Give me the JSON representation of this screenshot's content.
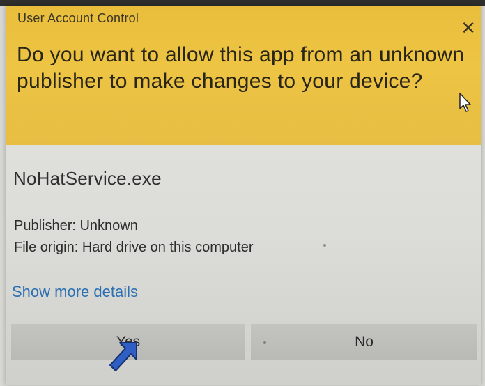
{
  "window": {
    "title": "User Account Control",
    "close_symbol": "✕"
  },
  "header": {
    "question": "Do you want to allow this app from an unknown publisher to make changes to your device?",
    "background_color": "#ecc342"
  },
  "app": {
    "name": "NoHatService.exe",
    "publisher": "Publisher: Unknown",
    "file_origin": "File origin: Hard drive on this computer"
  },
  "links": {
    "show_more_details": "Show more details",
    "link_color": "#2c6fb3"
  },
  "buttons": {
    "yes_label": "Yes",
    "no_label": "No"
  },
  "icons": {
    "close": "close-icon",
    "mouse_cursor": "mouse-cursor-icon",
    "pointing_arrow": "blue-arrow-icon"
  }
}
